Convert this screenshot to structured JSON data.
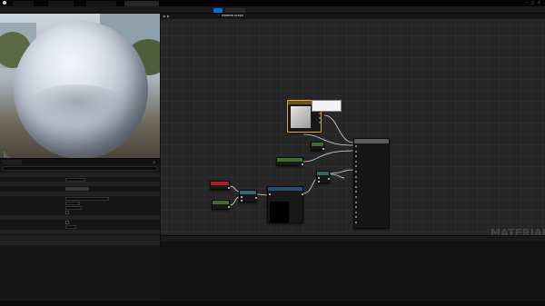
{
  "window": {
    "tabs": [
      "",
      "",
      "",
      ""
    ],
    "active_tab": 3
  },
  "toolbar": {
    "items": [
      ""
    ],
    "primary_label": "",
    "end_label": ""
  },
  "viewport": {
    "title": ""
  },
  "details": {
    "tabs": [
      "",
      ""
    ],
    "rows": [
      "",
      "",
      "",
      "",
      "",
      "",
      "",
      "",
      "",
      "",
      "",
      "",
      "",
      "",
      "",
      "",
      "",
      ""
    ],
    "values": {
      "blend_mode": "",
      "shading_model": ""
    }
  },
  "graph": {
    "breadcrumb_root": "",
    "breadcrumb_current": "Material Graph",
    "tag": "MATERIAL",
    "texture_tooltip_title": "",
    "texture_tooltip_detail": "",
    "result_node_title": "",
    "result_pins": [
      "",
      "",
      "",
      "",
      "",
      "",
      "",
      "",
      "",
      "",
      "",
      "",
      "",
      "",
      "",
      ""
    ],
    "node_titles": {
      "n1": "",
      "n2": "",
      "n3": "",
      "n4": "",
      "n5": "",
      "n6": "",
      "n7": ""
    }
  },
  "output_log": {
    "tab": "",
    "lines": [
      "",
      "",
      "",
      "",
      ""
    ]
  },
  "status": {
    "left": [
      "",
      "",
      ""
    ],
    "right": [
      ""
    ]
  },
  "colors": {
    "accent": "#0070e0",
    "param_red": "#a8202a",
    "const_green": "#3f6e2a",
    "texture_orange": "#e8a14a"
  }
}
